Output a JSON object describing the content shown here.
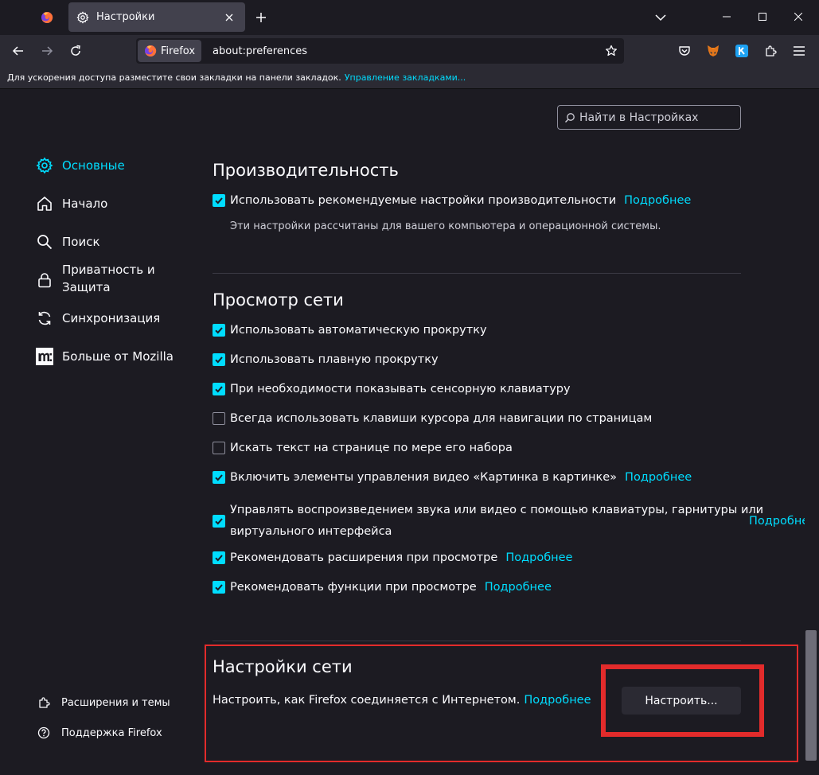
{
  "tabs": {
    "active_title": "Настройки"
  },
  "urlbar": {
    "identity_label": "Firefox",
    "url": "about:preferences"
  },
  "bookmarks_bar": {
    "text": "Для ускорения доступа разместите свои закладки на панели закладок.",
    "link": "Управление закладками..."
  },
  "search": {
    "placeholder": "Найти в Настройках"
  },
  "sidebar": {
    "categories": [
      {
        "label": "Основные",
        "icon": "gear-icon",
        "selected": true
      },
      {
        "label": "Начало",
        "icon": "home-icon"
      },
      {
        "label": "Поиск",
        "icon": "search-icon"
      },
      {
        "label": "Приватность и Защита",
        "icon": "lock-icon"
      },
      {
        "label": "Синхронизация",
        "icon": "sync-icon"
      },
      {
        "label": "Больше от Mozilla",
        "icon": "mozilla-icon"
      }
    ],
    "footer": [
      {
        "label": "Расширения и темы",
        "icon": "puzzle-icon"
      },
      {
        "label": "Поддержка Firefox",
        "icon": "help-icon"
      }
    ]
  },
  "performance": {
    "title": "Производительность",
    "recommended": {
      "label": "Использовать рекомендуемые настройки производительности",
      "checked": true,
      "link": "Подробнее"
    },
    "description": "Эти настройки рассчитаны для вашего компьютера и операционной системы."
  },
  "browsing": {
    "title": "Просмотр сети",
    "options": [
      {
        "label": "Использовать автоматическую прокрутку",
        "checked": true
      },
      {
        "label": "Использовать плавную прокрутку",
        "checked": true
      },
      {
        "label": "При необходимости показывать сенсорную клавиатуру",
        "checked": true
      },
      {
        "label": "Всегда использовать клавиши курсора для навигации по страницам",
        "checked": false
      },
      {
        "label": "Искать текст на странице по мере его набора",
        "checked": false
      },
      {
        "label": "Включить элементы управления видео «Картинка в картинке»",
        "checked": true,
        "link": "Подробнее"
      },
      {
        "label_line1": "Управлять воспроизведением звука или видео с помощью клавиатуры, гарнитуры или",
        "label_line2": "виртуального интерфейса",
        "checked": true,
        "link": "Подробнее"
      },
      {
        "label": "Рекомендовать расширения при просмотре",
        "checked": true,
        "link": "Подробнее"
      },
      {
        "label": "Рекомендовать функции при просмотре",
        "checked": true,
        "link": "Подробнее"
      }
    ]
  },
  "network": {
    "title": "Настройки сети",
    "description": "Настроить, как Firefox соединяется с Интернетом.",
    "link": "Подробнее",
    "button": "Настроить..."
  },
  "colors": {
    "accent": "#00ddff",
    "background": "#1c1b22",
    "toolbar": "#2b2a33",
    "highlight": "#e22b2b"
  }
}
